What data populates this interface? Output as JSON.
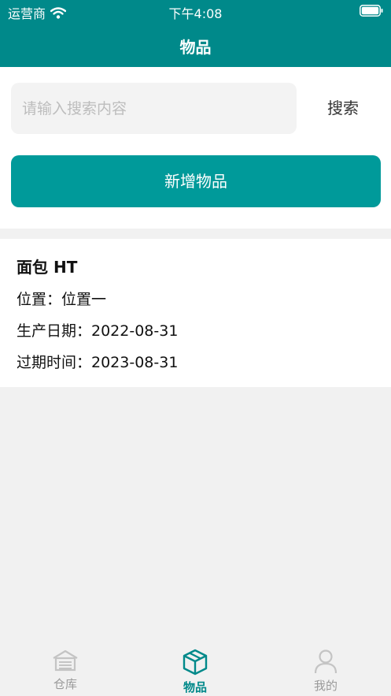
{
  "status_bar": {
    "carrier": "运营商",
    "time": "下午4:08"
  },
  "nav": {
    "title": "物品"
  },
  "search": {
    "placeholder": "请输入搜索内容",
    "value": "",
    "button_label": "搜索"
  },
  "add_button_label": "新增物品",
  "items": [
    {
      "name": "面包 HT",
      "location": "位置：位置一",
      "production_date": "生产日期：2022-08-31",
      "expiry_date": "过期时间：2023-08-31"
    }
  ],
  "tabs": [
    {
      "label": "仓库",
      "icon": "warehouse-icon",
      "active": false
    },
    {
      "label": "物品",
      "icon": "box-icon",
      "active": true
    },
    {
      "label": "我的",
      "icon": "user-icon",
      "active": false
    }
  ],
  "colors": {
    "primary": "#00898a",
    "button": "#009a9a",
    "inactive": "#9a9a9a",
    "background": "#f1f1f1"
  }
}
